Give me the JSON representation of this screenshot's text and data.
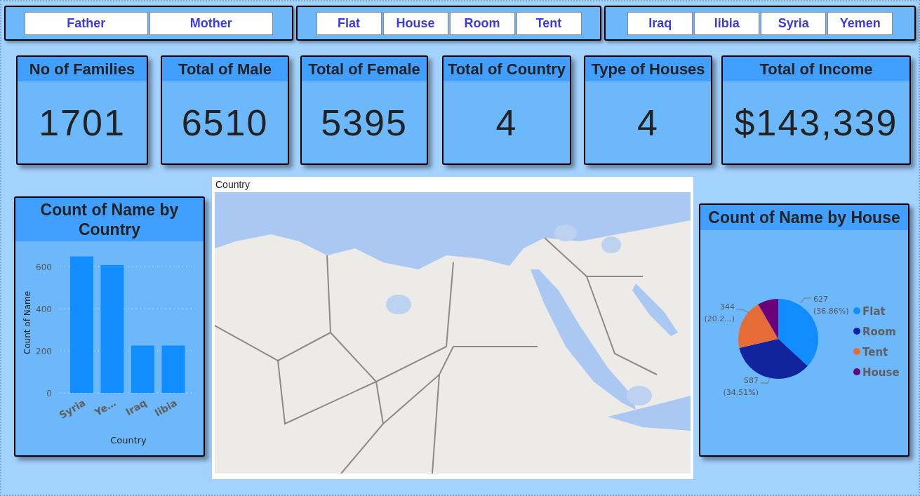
{
  "slicers": [
    {
      "items": [
        "Father",
        "Mother"
      ]
    },
    {
      "items": [
        "Flat",
        "House",
        "Room",
        "Tent"
      ]
    },
    {
      "items": [
        "Iraq",
        "libia",
        "Syria",
        "Yemen"
      ]
    }
  ],
  "cards": [
    {
      "title": "No of Families",
      "value": "1701"
    },
    {
      "title": "Total of Male",
      "value": "6510"
    },
    {
      "title": "Total of Female",
      "value": "5395"
    },
    {
      "title": "Total of Country",
      "value": "4"
    },
    {
      "title": "Type of Houses",
      "value": "4"
    },
    {
      "title": "Total of Income",
      "value": "$143,339"
    }
  ],
  "bar_chart": {
    "chart_data": {
      "type": "bar",
      "title": "Count of Name by Country",
      "xlabel": "Country",
      "ylabel": "Count of Name",
      "categories": [
        "Syria",
        "Ye…",
        "Iraq",
        "libia"
      ],
      "values": [
        648,
        607,
        225,
        225
      ],
      "ylim": [
        0,
        650
      ],
      "yticks": [
        0,
        200,
        400,
        600
      ],
      "grid": true
    }
  },
  "map": {
    "title": "Country",
    "kind": "picture"
  },
  "pie_chart": {
    "chart_data": {
      "type": "pie",
      "title": "Count of Name by House",
      "categories": [
        "Flat",
        "Room",
        "Tent",
        "House"
      ],
      "values": [
        36.86,
        34.51,
        20.22,
        8.41
      ],
      "colors": [
        "#118dff",
        "#12239e",
        "#e66c37",
        "#6b007b"
      ],
      "legend": "right",
      "value_labels": [
        [
          "627",
          "(36.86%)"
        ],
        [
          "587",
          "(34.51%)"
        ],
        [
          "344",
          "(20.2...)"
        ],
        null
      ]
    }
  }
}
